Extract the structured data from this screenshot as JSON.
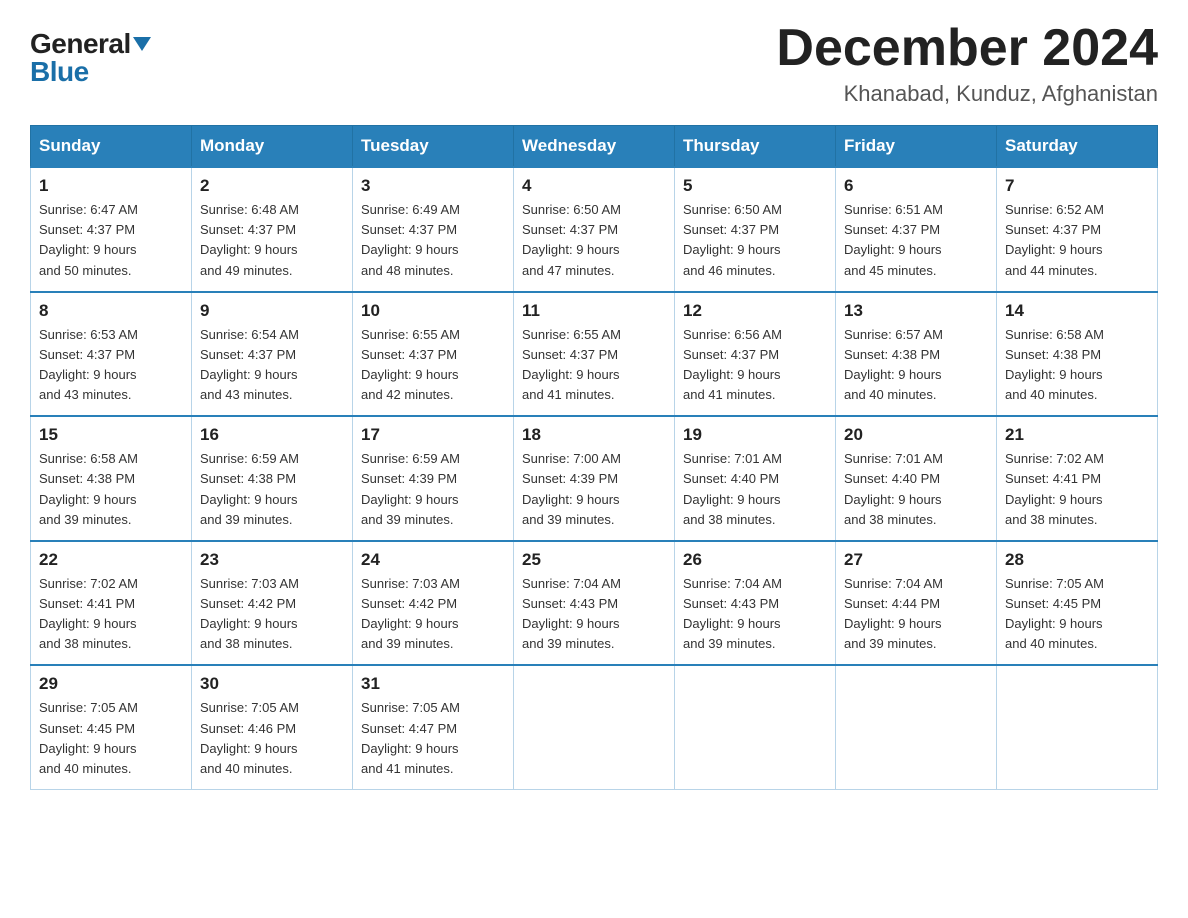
{
  "header": {
    "logo": {
      "general": "General",
      "blue": "Blue"
    },
    "title": "December 2024",
    "location": "Khanabad, Kunduz, Afghanistan"
  },
  "calendar": {
    "days_of_week": [
      "Sunday",
      "Monday",
      "Tuesday",
      "Wednesday",
      "Thursday",
      "Friday",
      "Saturday"
    ],
    "weeks": [
      [
        {
          "day": "1",
          "sunrise": "6:47 AM",
          "sunset": "4:37 PM",
          "daylight": "9 hours and 50 minutes."
        },
        {
          "day": "2",
          "sunrise": "6:48 AM",
          "sunset": "4:37 PM",
          "daylight": "9 hours and 49 minutes."
        },
        {
          "day": "3",
          "sunrise": "6:49 AM",
          "sunset": "4:37 PM",
          "daylight": "9 hours and 48 minutes."
        },
        {
          "day": "4",
          "sunrise": "6:50 AM",
          "sunset": "4:37 PM",
          "daylight": "9 hours and 47 minutes."
        },
        {
          "day": "5",
          "sunrise": "6:50 AM",
          "sunset": "4:37 PM",
          "daylight": "9 hours and 46 minutes."
        },
        {
          "day": "6",
          "sunrise": "6:51 AM",
          "sunset": "4:37 PM",
          "daylight": "9 hours and 45 minutes."
        },
        {
          "day": "7",
          "sunrise": "6:52 AM",
          "sunset": "4:37 PM",
          "daylight": "9 hours and 44 minutes."
        }
      ],
      [
        {
          "day": "8",
          "sunrise": "6:53 AM",
          "sunset": "4:37 PM",
          "daylight": "9 hours and 43 minutes."
        },
        {
          "day": "9",
          "sunrise": "6:54 AM",
          "sunset": "4:37 PM",
          "daylight": "9 hours and 43 minutes."
        },
        {
          "day": "10",
          "sunrise": "6:55 AM",
          "sunset": "4:37 PM",
          "daylight": "9 hours and 42 minutes."
        },
        {
          "day": "11",
          "sunrise": "6:55 AM",
          "sunset": "4:37 PM",
          "daylight": "9 hours and 41 minutes."
        },
        {
          "day": "12",
          "sunrise": "6:56 AM",
          "sunset": "4:37 PM",
          "daylight": "9 hours and 41 minutes."
        },
        {
          "day": "13",
          "sunrise": "6:57 AM",
          "sunset": "4:38 PM",
          "daylight": "9 hours and 40 minutes."
        },
        {
          "day": "14",
          "sunrise": "6:58 AM",
          "sunset": "4:38 PM",
          "daylight": "9 hours and 40 minutes."
        }
      ],
      [
        {
          "day": "15",
          "sunrise": "6:58 AM",
          "sunset": "4:38 PM",
          "daylight": "9 hours and 39 minutes."
        },
        {
          "day": "16",
          "sunrise": "6:59 AM",
          "sunset": "4:38 PM",
          "daylight": "9 hours and 39 minutes."
        },
        {
          "day": "17",
          "sunrise": "6:59 AM",
          "sunset": "4:39 PM",
          "daylight": "9 hours and 39 minutes."
        },
        {
          "day": "18",
          "sunrise": "7:00 AM",
          "sunset": "4:39 PM",
          "daylight": "9 hours and 39 minutes."
        },
        {
          "day": "19",
          "sunrise": "7:01 AM",
          "sunset": "4:40 PM",
          "daylight": "9 hours and 38 minutes."
        },
        {
          "day": "20",
          "sunrise": "7:01 AM",
          "sunset": "4:40 PM",
          "daylight": "9 hours and 38 minutes."
        },
        {
          "day": "21",
          "sunrise": "7:02 AM",
          "sunset": "4:41 PM",
          "daylight": "9 hours and 38 minutes."
        }
      ],
      [
        {
          "day": "22",
          "sunrise": "7:02 AM",
          "sunset": "4:41 PM",
          "daylight": "9 hours and 38 minutes."
        },
        {
          "day": "23",
          "sunrise": "7:03 AM",
          "sunset": "4:42 PM",
          "daylight": "9 hours and 38 minutes."
        },
        {
          "day": "24",
          "sunrise": "7:03 AM",
          "sunset": "4:42 PM",
          "daylight": "9 hours and 39 minutes."
        },
        {
          "day": "25",
          "sunrise": "7:04 AM",
          "sunset": "4:43 PM",
          "daylight": "9 hours and 39 minutes."
        },
        {
          "day": "26",
          "sunrise": "7:04 AM",
          "sunset": "4:43 PM",
          "daylight": "9 hours and 39 minutes."
        },
        {
          "day": "27",
          "sunrise": "7:04 AM",
          "sunset": "4:44 PM",
          "daylight": "9 hours and 39 minutes."
        },
        {
          "day": "28",
          "sunrise": "7:05 AM",
          "sunset": "4:45 PM",
          "daylight": "9 hours and 40 minutes."
        }
      ],
      [
        {
          "day": "29",
          "sunrise": "7:05 AM",
          "sunset": "4:45 PM",
          "daylight": "9 hours and 40 minutes."
        },
        {
          "day": "30",
          "sunrise": "7:05 AM",
          "sunset": "4:46 PM",
          "daylight": "9 hours and 40 minutes."
        },
        {
          "day": "31",
          "sunrise": "7:05 AM",
          "sunset": "4:47 PM",
          "daylight": "9 hours and 41 minutes."
        },
        null,
        null,
        null,
        null
      ]
    ],
    "labels": {
      "sunrise": "Sunrise:",
      "sunset": "Sunset:",
      "daylight": "Daylight:"
    }
  }
}
